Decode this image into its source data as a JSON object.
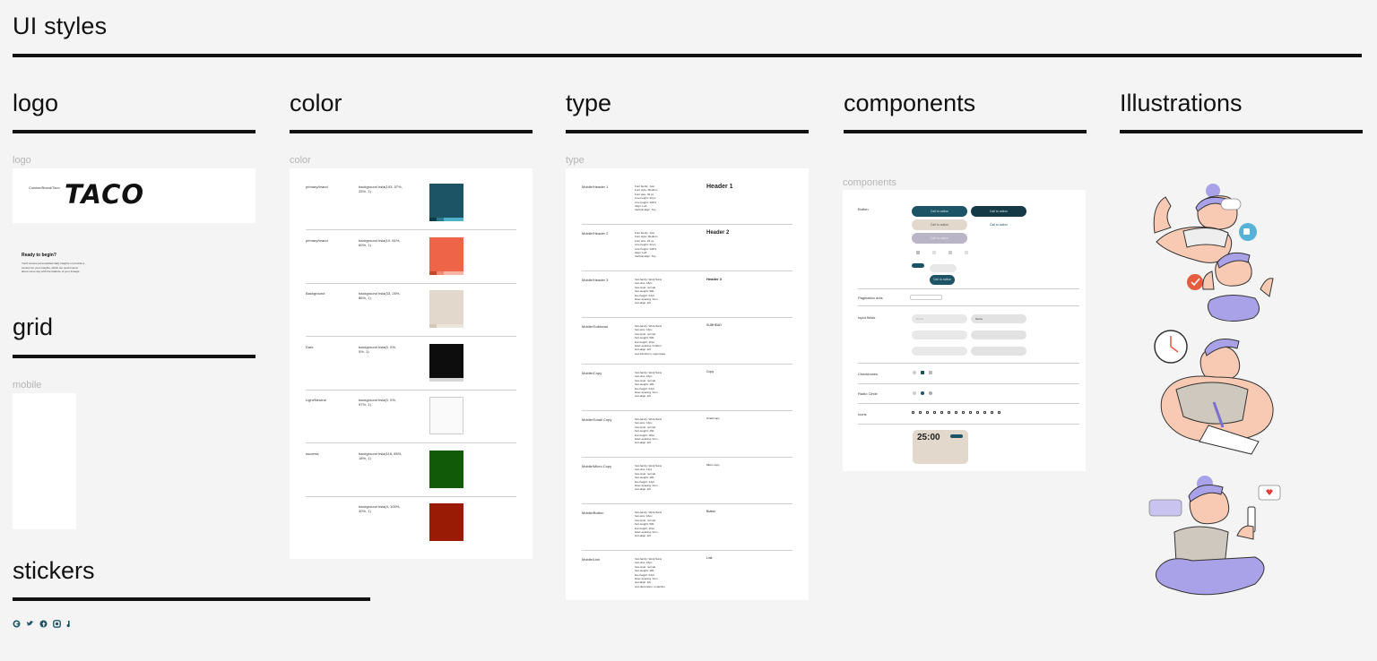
{
  "page": {
    "title": "UI styles"
  },
  "sections": {
    "logo": "logo",
    "color": "color",
    "type": "type",
    "components": "components",
    "illustrations": "Illustrations",
    "grid": "grid",
    "stickers": "stickers"
  },
  "frames": {
    "logo": "logo",
    "color": "color",
    "type": "type",
    "components": "components",
    "mobile": "mobile"
  },
  "logo_card": {
    "caption": "Cuisine/Brand/Taco",
    "wordmark": "TACO"
  },
  "ready_card": {
    "title": "Ready to begin?",
    "body": "You'll receive personalized daily insights or provide a content for your insights, which we recommend about some day with the balance of your lineage."
  },
  "color_rows": [
    {
      "name": "primary/brand",
      "desc": "background hsla(193, 57%, 25%, 1)",
      "color": "#1c5466",
      "chips": [
        "#0f3a48",
        "#2b7a90",
        "#4fb0c8"
      ]
    },
    {
      "name": "primary/brand",
      "desc": "background hsla(10, 81%, 60%, 1)",
      "color": "#ee6449",
      "chips": [
        "#c9452b",
        "#f08a73",
        "#f6b5a6"
      ]
    },
    {
      "name": "Background",
      "desc": "background hsla(33, 26%, 86%, 1)",
      "color": "#e2d8cc",
      "chips": [
        "#d5c8b8",
        "#ebe4da"
      ]
    },
    {
      "name": "Dark",
      "desc": "background hsla(0, 0%, 5%, 1)",
      "color": "#0d0d0d",
      "chips": [
        "#d6d6d6"
      ]
    },
    {
      "name": "Light/Neutral",
      "desc": "background hsla(0, 0%, 97%, 1)",
      "color": "#fafafa",
      "chips": []
    },
    {
      "name": "success",
      "desc": "background hsla(116, 85%, 18%, 1)",
      "color": "#115a08",
      "chips": []
    },
    {
      "name": "",
      "desc": "background hsla(4, 100%, 30%, 1)",
      "color": "#9a1b05",
      "chips": []
    }
  ],
  "type_rows": [
    {
      "name": "Mobile/Header 1",
      "specs": "Font family: Jost\nFont style: Medium\nFont size: 32 px\nLine height: 40 px\nLine height: 125%\nAlign: Left\nVertical align: Top",
      "sample": "Header 1"
    },
    {
      "name": "Mobile/Header 2",
      "specs": "Font family: Jost\nFont style: Medium\nFont size: 24 px\nLine height: 32 px\nLine height: 133%\nAlign: Left\nVertical align: Top",
      "sample": "Header 2"
    },
    {
      "name": "Mobile/Header 3",
      "specs": "font-family: Work Sans\nfont-size: 18px\nfont-style: normal\nfont-weight: 500\nline-height: 24px\nletter-spacing: 0em\ntext-align: left",
      "sample": "Header 3"
    },
    {
      "name": "Mobile/Subhead",
      "specs": "font-family: Work Sans\nfont-size: 13px\nfont-style: normal\nfont-weight: 500\nline-height: 16px\nletter-spacing: 0.02em\ntext-align: left\ntext-transform: uppercase",
      "sample": "SUBHEAD"
    },
    {
      "name": "Mobile/Copy",
      "specs": "font-family: Work Sans\nfont-size: 16px\nfont-style: normal\nfont-weight: 400\nline-height: 24px\nletter-spacing: 0em\ntext-align: left",
      "sample": "Copy"
    },
    {
      "name": "Mobile/Small Copy",
      "specs": "font-family: Work Sans\nfont-size: 13px\nfont-style: normal\nfont-weight: 400\nline-height: 18px\nletter-spacing: 0em\ntext-align: left",
      "sample": "Small copy"
    },
    {
      "name": "Mobile/Micro Copy",
      "specs": "font-family: Work Sans\nfont-size: 11px\nfont-style: normal\nfont-weight: 400\nline-height: 14px\nletter-spacing: 0em\ntext-align: left",
      "sample": "Micro copy"
    },
    {
      "name": "Mobile/Button",
      "specs": "font-family: Work Sans\nfont-size: 16px\nfont-style: normal\nfont-weight: 500\nline-height: 16px\nletter-spacing: 0em\ntext-align: left",
      "sample": "Button"
    },
    {
      "name": "Mobile/Link",
      "specs": "font-family: Work Sans\nfont-size: 16px\nfont-style: normal\nfont-weight: 400\nline-height: 24px\nletter-spacing: 0em\ntext-align: left\ntext-decoration: underline",
      "sample": "Link"
    }
  ],
  "components": {
    "buttons_label": "Button",
    "btn_primary": "Call to action",
    "btn_dark": "Call to action",
    "btn_light": "Call to action",
    "btn_text": "Call to action",
    "btn_disabled": "Call to action",
    "btn_small": "Call to action",
    "pagination_label": "Pagination dots",
    "input_label": "Input fields",
    "input_placeholder": "Name",
    "input_filled": "Name",
    "checkboxes_label": "Checkboxes",
    "radio_label": "Radio Circle",
    "icons_label": "Icons",
    "timer": "25:00"
  },
  "colors": {
    "brand": "#1c5466",
    "dark_btn": "#153a45",
    "bg_beige": "#e2d8cc",
    "lavender": "#a9a2e8",
    "skin": "#f8c9b3"
  }
}
